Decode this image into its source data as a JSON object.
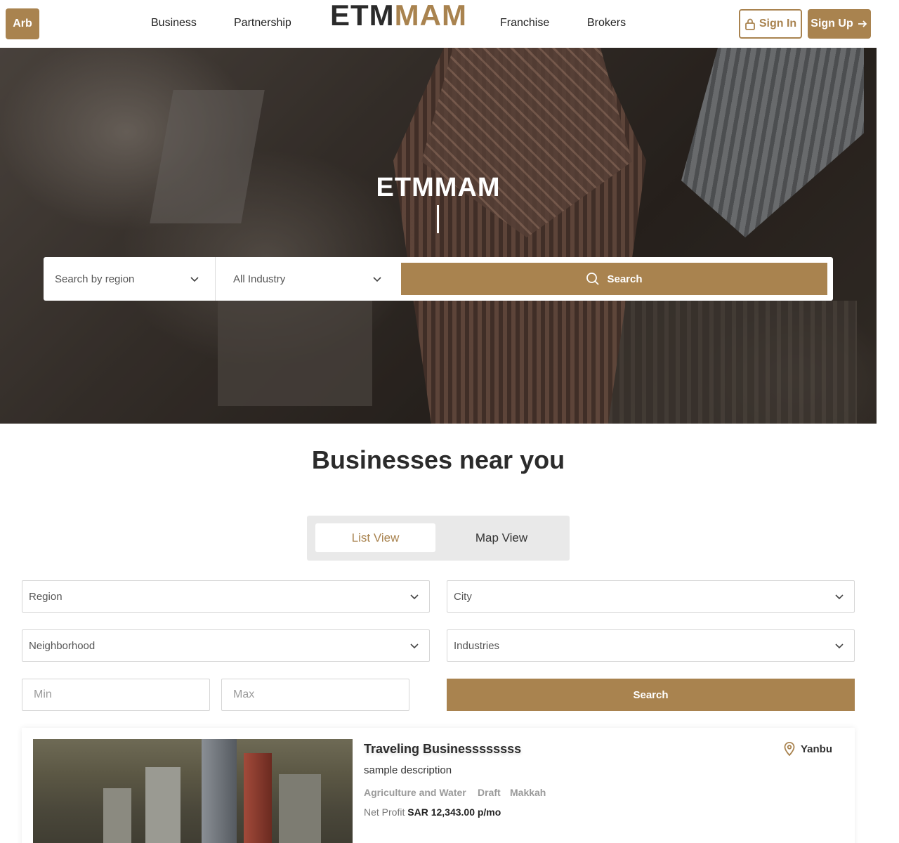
{
  "header": {
    "lang_label": "Arb",
    "nav": [
      "Business",
      "Partnership",
      "Franchise",
      "Brokers"
    ],
    "logo_part1": "ETM",
    "logo_part2": "MAM",
    "signin_label": "Sign In",
    "signup_label": "Sign Up",
    "accent_color": "#a9834f"
  },
  "hero": {
    "title": "ETMMAM",
    "region_placeholder": "Search by region",
    "industry_placeholder": "All Industry",
    "search_label": "Search"
  },
  "section": {
    "title": "Businesses near you",
    "tabs": {
      "list": "List View",
      "map": "Map View"
    },
    "active_tab": "List View"
  },
  "filters": {
    "region": "Region",
    "city": "City",
    "neighborhood": "Neighborhood",
    "industries": "Industries",
    "min_placeholder": "Min",
    "max_placeholder": "Max",
    "search_label": "Search"
  },
  "listings": [
    {
      "title": "Traveling Businessssssss",
      "description": "sample description",
      "tags": [
        "Agriculture and Water",
        "Draft",
        "Makkah"
      ],
      "profit_label": "Net Profit",
      "profit_value": "SAR 12,343.00 p/mo",
      "location": "Yanbu"
    }
  ],
  "icons": {
    "lock": "lock-icon",
    "arrow": "arrow-right-icon",
    "search": "search-icon",
    "chevron": "chevron-down-icon",
    "pin": "map-pin-icon"
  }
}
